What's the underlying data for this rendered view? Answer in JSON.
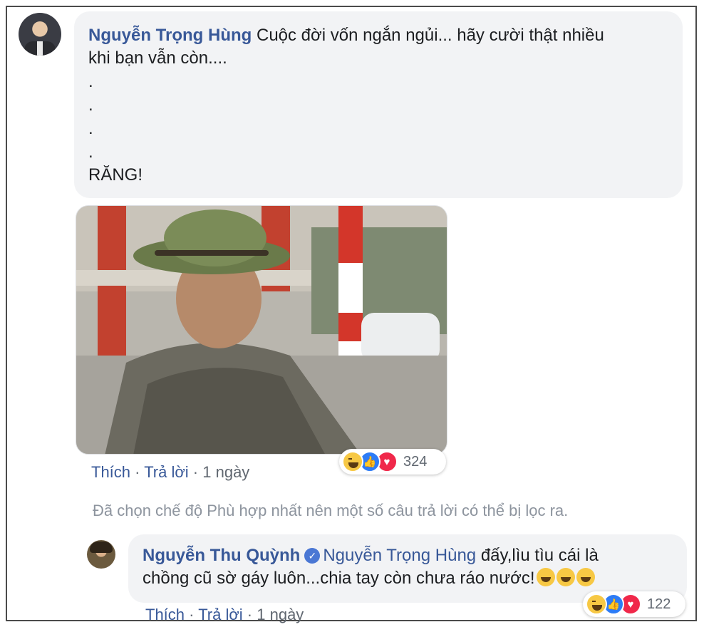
{
  "comment": {
    "author": "Nguyễn Trọng Hùng",
    "line1": "Cuộc đời vốn ngắn ngủi... hãy cười thật nhiều",
    "line2": "khi bạn vẫn còn....",
    "dots": [
      ".",
      ".",
      ".",
      "."
    ],
    "final": "RĂNG!",
    "actions": {
      "like": "Thích",
      "sep": " · ",
      "reply": "Trả lời",
      "time": "1 ngày"
    },
    "reactions": {
      "icons": [
        "haha-icon",
        "like-icon",
        "love-icon"
      ],
      "count": "324"
    }
  },
  "filter_note": "Đã chọn chế độ Phù hợp nhất nên một số câu trả lời có thể bị lọc ra.",
  "reply": {
    "author": "Nguyễn Thu Quỳnh",
    "mention": "Nguyễn Trọng Hùng",
    "text1": "đấy,lìu tìu cái là",
    "text2": "chồng cũ sờ gáy luôn...chia tay còn chưa ráo nước!",
    "emojis": [
      "rolling-on-floor-laughing-icon",
      "rolling-on-floor-laughing-icon",
      "rolling-on-floor-laughing-icon"
    ],
    "actions": {
      "like": "Thích",
      "sep": " · ",
      "reply": "Trả lời",
      "time": "1 ngày"
    },
    "reactions": {
      "icons": [
        "haha-icon",
        "like-icon",
        "love-icon"
      ],
      "count": "122"
    }
  },
  "colors": {
    "link": "#385898",
    "bubble": "#f2f3f5",
    "muted": "#606770",
    "like": "#2d7cf6",
    "love": "#f0284a",
    "haha": "#f7c844"
  }
}
